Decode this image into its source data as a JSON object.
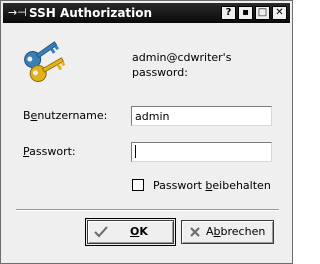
{
  "window": {
    "title": "SSH Authorization",
    "title_icon": "→⊣",
    "buttons": {
      "help": "?",
      "minimize": "▪",
      "maximize": "□",
      "close": "✕"
    }
  },
  "dialog": {
    "prompt_line1": "admin@cdwriter's",
    "prompt_line2": "password:",
    "username": {
      "label_pre": "B",
      "label_u": "e",
      "label_post": "nutzername:",
      "value": "admin"
    },
    "password": {
      "label_pre": "",
      "label_u": "P",
      "label_post": "asswort:",
      "value": ""
    },
    "remember": {
      "label_pre": "Passwort ",
      "label_u": "b",
      "label_post": "eibehalten",
      "checked": false
    },
    "ok_button": {
      "u": "O",
      "rest": "K"
    },
    "cancel_button": {
      "pre": "A",
      "u": "b",
      "post": "brechen"
    }
  },
  "colors": {
    "titlebar": "#111111",
    "window_bg": "#efefef",
    "key_gold": "#e2b21c",
    "key_blue": "#3a7fb8"
  }
}
